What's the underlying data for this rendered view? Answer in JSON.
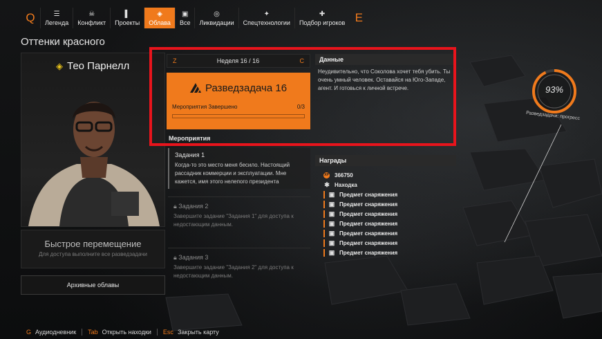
{
  "nav": {
    "left_key": "Q",
    "right_key": "E",
    "items": [
      {
        "label": "Легенда",
        "icon": "legend-icon",
        "glyph": "☰"
      },
      {
        "label": "Конфликт",
        "icon": "conflict-icon",
        "glyph": "☠"
      },
      {
        "label": "Проекты",
        "icon": "projects-icon",
        "glyph": "▌"
      },
      {
        "label": "Облава",
        "icon": "manhunt-icon",
        "glyph": "◈"
      },
      {
        "label": "Все",
        "icon": "all-icon",
        "glyph": "▣"
      },
      {
        "label": "Ликвидации",
        "icon": "target-icon",
        "glyph": "◎"
      },
      {
        "label": "Спецтехнологии",
        "icon": "tech-icon",
        "glyph": "✦"
      },
      {
        "label": "Подбор игроков",
        "icon": "matchmaking-icon",
        "glyph": "✚"
      }
    ],
    "active_index": 3
  },
  "page_title": "Оттенки красного",
  "character": {
    "name": "Тео Парнелл",
    "badge_glyph": "◈"
  },
  "fast_travel": {
    "title": "Быстрое перемещение",
    "subtitle": "Для доступа выполните все разведзадачи"
  },
  "archive_button": "Архивные облавы",
  "week": {
    "left_key": "Z",
    "label": "Неделя 16 / 16",
    "right_key": "C"
  },
  "mission": {
    "title": "Разведзадача 16",
    "status": "Мероприятия Завершено",
    "count": "0/3",
    "progress": 0
  },
  "activities_label": "Мероприятия",
  "tasks": [
    {
      "title": "Задания 1",
      "text": "Когда-то это место меня бесило. Настоящий рассадник коммерции и эксплуатации. Мне кажется, имя этого нелепого президента",
      "locked": false
    },
    {
      "title": "Задания 2",
      "text": "Завершите задание \"Задания 1\" для доступа к недостающим данным.",
      "locked": true
    },
    {
      "title": "Задания 3",
      "text": "Завершите задание \"Задания 2\" для доступа к недостающим данным.",
      "locked": true
    }
  ],
  "data_panel": {
    "header": "Данные",
    "text": "Неудивительно, что Соколова хочет тебя убить. Ты очень умный человек. Оставайся на Юго-Западе, агент. И готовься к личной встрече."
  },
  "rewards": {
    "header": "Награды",
    "xp_label": "XP",
    "items": [
      {
        "label": "366750",
        "type": "xp"
      },
      {
        "label": "Находка",
        "type": "find"
      },
      {
        "label": "Предмет снаряжения",
        "type": "gear"
      },
      {
        "label": "Предмет снаряжения",
        "type": "gear"
      },
      {
        "label": "Предмет снаряжения",
        "type": "gear"
      },
      {
        "label": "Предмет снаряжения",
        "type": "gear"
      },
      {
        "label": "Предмет снаряжения",
        "type": "gear"
      },
      {
        "label": "Предмет снаряжения",
        "type": "gear"
      },
      {
        "label": "Предмет снаряжения",
        "type": "gear"
      }
    ]
  },
  "progress_ring": {
    "percent_text": "93%",
    "value": 0.93,
    "label": "Разведзадачи: прогресс"
  },
  "footer": [
    {
      "key": "G",
      "label": "Аудиодневник"
    },
    {
      "key": "Tab",
      "label": "Открыть находки"
    },
    {
      "key": "Esc",
      "label": "Закрыть карту"
    }
  ],
  "colors": {
    "accent": "#f07a1c",
    "highlight": "#e8141c"
  }
}
